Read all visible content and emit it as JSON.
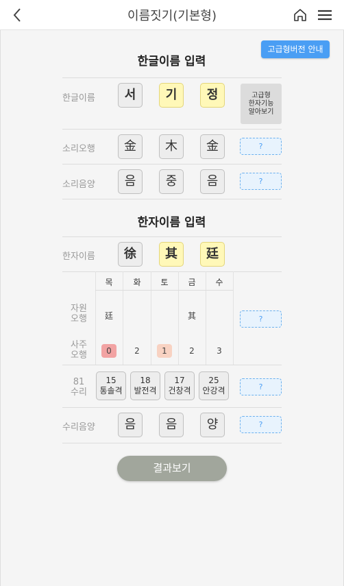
{
  "header": {
    "title": "이름짓기(기본형)"
  },
  "pro_button": "고급형버전 안내",
  "hangul_section": {
    "title": "한글이름 입력",
    "name_label": "한글이름",
    "chars": [
      "서",
      "기",
      "정"
    ],
    "advanced_button": [
      "고급형",
      "한자기능",
      "알아보기"
    ],
    "sound_label": "소리오행",
    "sound": [
      "金",
      "木",
      "金"
    ],
    "yinyang_label": "소리음양",
    "yinyang": [
      "음",
      "중",
      "음"
    ]
  },
  "hanja_section": {
    "title": "한자이름 입력",
    "name_label": "한자이름",
    "chars": [
      "徐",
      "其",
      "廷"
    ],
    "element_headers": [
      "목",
      "화",
      "토",
      "금",
      "수"
    ],
    "jawon_label": [
      "자원",
      "오행"
    ],
    "jawon_values": [
      "廷",
      "",
      "",
      "其",
      ""
    ],
    "saju_label": [
      "사주",
      "오행"
    ],
    "saju_values": [
      "0",
      "2",
      "1",
      "2",
      "3"
    ],
    "suri_label": [
      "81",
      "수리"
    ],
    "suri": [
      {
        "num": "15",
        "name": "통솔격"
      },
      {
        "num": "18",
        "name": "발전격"
      },
      {
        "num": "17",
        "name": "건창격"
      },
      {
        "num": "25",
        "name": "안강격"
      }
    ],
    "suri_yinyang_label": "수리음양",
    "suri_yinyang": [
      "음",
      "음",
      "양"
    ]
  },
  "help_label": "?",
  "result_button": "결과보기",
  "colors": {
    "accent": "#4a9ef4",
    "yellow": "#fff8b8",
    "saju_zero": "#f2a3a3",
    "saju_one": "#f8d2c2",
    "result": "#a1a69c"
  }
}
